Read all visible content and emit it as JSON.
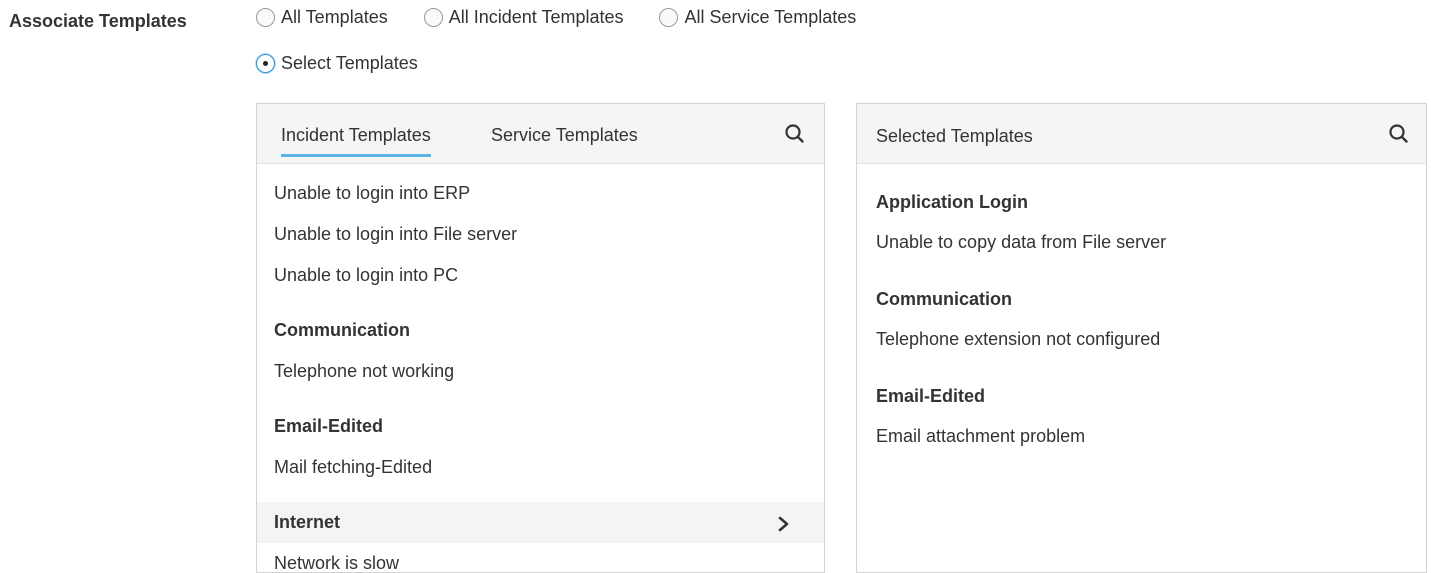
{
  "form": {
    "label": "Associate Templates"
  },
  "radios": [
    {
      "label": "All Templates",
      "checked": false
    },
    {
      "label": "All Incident Templates",
      "checked": false
    },
    {
      "label": "All Service Templates",
      "checked": false
    },
    {
      "label": "Select Templates",
      "checked": true
    }
  ],
  "available": {
    "tabs": [
      "Incident Templates",
      "Service Templates"
    ],
    "active_tab": "Incident Templates",
    "search_icon": "search-icon",
    "items_top": [
      "Unable to login into ERP",
      "Unable to login into File server",
      "Unable to login into PC"
    ],
    "groups": [
      {
        "name": "Communication",
        "items": [
          "Telephone not working"
        ]
      },
      {
        "name": "Email-Edited",
        "items": [
          "Mail fetching-Edited"
        ]
      },
      {
        "name": "Internet",
        "items": [
          "Network is slow"
        ],
        "icon": "chevron-right-icon"
      }
    ]
  },
  "selected": {
    "title": "Selected Templates",
    "search_icon": "search-icon",
    "groups": [
      {
        "name": "Application Login",
        "items": [
          "Unable to copy data from File server"
        ]
      },
      {
        "name": "Communication",
        "items": [
          "Telephone extension not configured"
        ]
      },
      {
        "name": "Email-Edited",
        "items": [
          "Email attachment problem"
        ]
      }
    ]
  },
  "colors": {
    "tab_underline": "#5ab4e5",
    "radio_checked_border": "#2a8fd0",
    "panel_border": "#d4d4d4",
    "header_bg": "#f5f5f5"
  }
}
